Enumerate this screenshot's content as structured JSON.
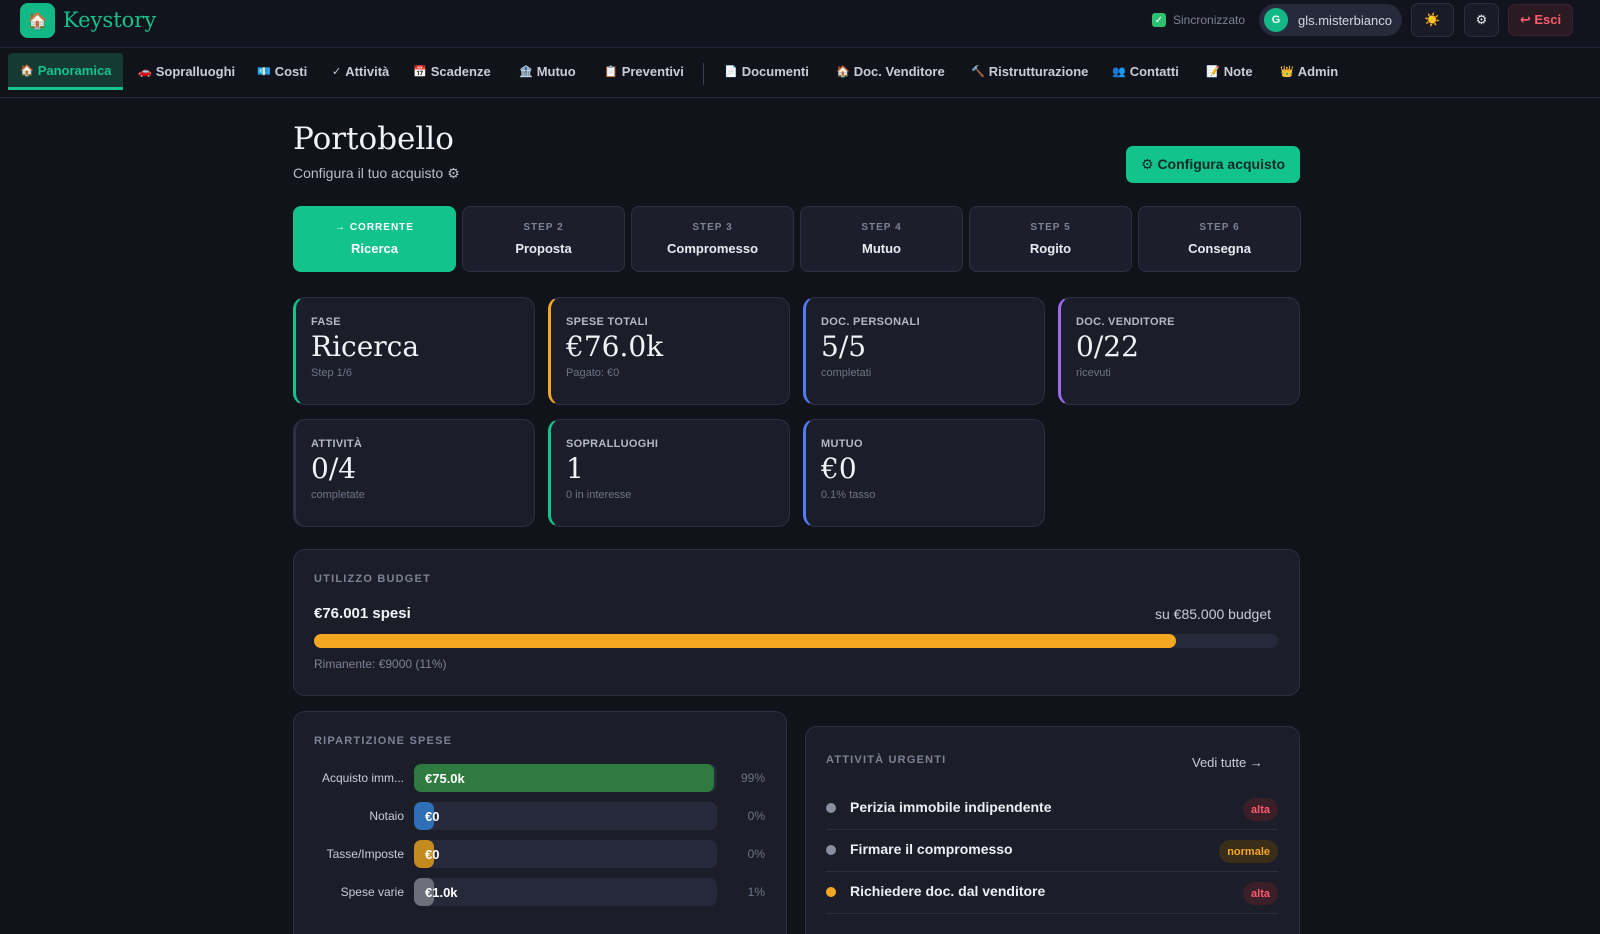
{
  "app": {
    "name": "Keystory",
    "logo_icon": "house-icon"
  },
  "topbar": {
    "sync_label": "Sincronizzato",
    "user_initial": "G",
    "user_name": "gls.misterbianco",
    "theme_icon": "☀️",
    "settings_icon": "⚙",
    "exit_label": "↩ Esci"
  },
  "nav": [
    {
      "icon": "🏠",
      "label": "Panoramica",
      "active": true
    },
    {
      "icon": "🚗",
      "label": "Sopralluoghi"
    },
    {
      "icon": "💶",
      "label": "Costi"
    },
    {
      "icon": "✓",
      "label": "Attività"
    },
    {
      "icon": "📅",
      "label": "Scadenze"
    },
    {
      "icon": "🏦",
      "label": "Mutuo"
    },
    {
      "icon": "📋",
      "label": "Preventivi"
    },
    {
      "icon": "📄",
      "label": "Documenti"
    },
    {
      "icon": "🏠",
      "label": "Doc. Venditore"
    },
    {
      "icon": "🔨",
      "label": "Ristrutturazione"
    },
    {
      "icon": "👥",
      "label": "Contatti"
    },
    {
      "icon": "📝",
      "label": "Note"
    },
    {
      "icon": "👑",
      "label": "Admin"
    }
  ],
  "header": {
    "title": "Portobello",
    "subtitle": "Configura il tuo acquisto ⚙",
    "configure_button": "⚙ Configura acquisto"
  },
  "steps": [
    {
      "top": "→ CORRENTE",
      "name": "Ricerca",
      "current": true
    },
    {
      "top": "STEP 2",
      "name": "Proposta"
    },
    {
      "top": "STEP 3",
      "name": "Compromesso"
    },
    {
      "top": "STEP 4",
      "name": "Mutuo"
    },
    {
      "top": "STEP 5",
      "name": "Rogito"
    },
    {
      "top": "STEP 6",
      "name": "Consegna"
    }
  ],
  "stats": [
    {
      "label": "FASE",
      "value": "Ricerca",
      "sub": "Step 1/6",
      "color": "#12c48b"
    },
    {
      "label": "SPESE TOTALI",
      "value": "€76.0k",
      "sub": "Pagato: €0",
      "color": "#f5a623"
    },
    {
      "label": "DOC. PERSONALI",
      "value": "5/5",
      "sub": "completati",
      "color": "#4f7cf7"
    },
    {
      "label": "DOC. VENDITORE",
      "value": "0/22",
      "sub": "ricevuti",
      "color": "#9b6cf0"
    },
    {
      "label": "ATTIVITÀ",
      "value": "0/4",
      "sub": "completate",
      "color": "#2c3042"
    },
    {
      "label": "SOPRALLUOGHI",
      "value": "1",
      "sub": "0 in interesse",
      "color": "#12c48b"
    },
    {
      "label": "MUTUO",
      "value": "€0",
      "sub": "0.1% tasso",
      "color": "#4f7cf7"
    }
  ],
  "budget": {
    "title": "UTILIZZO BUDGET",
    "spent_label": "€76.001 spesi",
    "of_label": "su €85.000 budget",
    "used_fraction": 0.894,
    "remaining_label": "Rimanente: €9000 (11%)",
    "bar_color": "#f5a623"
  },
  "breakdown": {
    "title": "RIPARTIZIONE SPESE",
    "rows": [
      {
        "label": "Acquisto imm...",
        "value": "€75.0k",
        "pct": "99%",
        "fraction": 0.99,
        "color": "#2f7a3e"
      },
      {
        "label": "Notaio",
        "value": "€0",
        "pct": "0%",
        "fraction": 0.0,
        "color": "#2f6fb5"
      },
      {
        "label": "Tasse/Imposte",
        "value": "€0",
        "pct": "0%",
        "fraction": 0.0,
        "color": "#c58a1e"
      },
      {
        "label": "Spese varie",
        "value": "€1.0k",
        "pct": "1%",
        "fraction": 0.01,
        "color": "#6d6f7a"
      }
    ]
  },
  "urgent": {
    "title": "ATTIVITÀ URGENTI",
    "see_all": "Vedi tutte →",
    "tasks": [
      {
        "name": "Perizia immobile indipendente",
        "priority": "alta",
        "dot_color": "#8a8fa0",
        "badge_color": "#ff5b6e",
        "badge_bg": "#3a1e28"
      },
      {
        "name": "Firmare il compromesso",
        "priority": "normale",
        "dot_color": "#8a8fa0",
        "badge_color": "#f5a623",
        "badge_bg": "#3a2e18"
      },
      {
        "name": "Richiedere doc. dal venditore",
        "priority": "alta",
        "dot_color": "#f5a623",
        "badge_color": "#ff5b6e",
        "badge_bg": "#3a1e28"
      }
    ]
  }
}
